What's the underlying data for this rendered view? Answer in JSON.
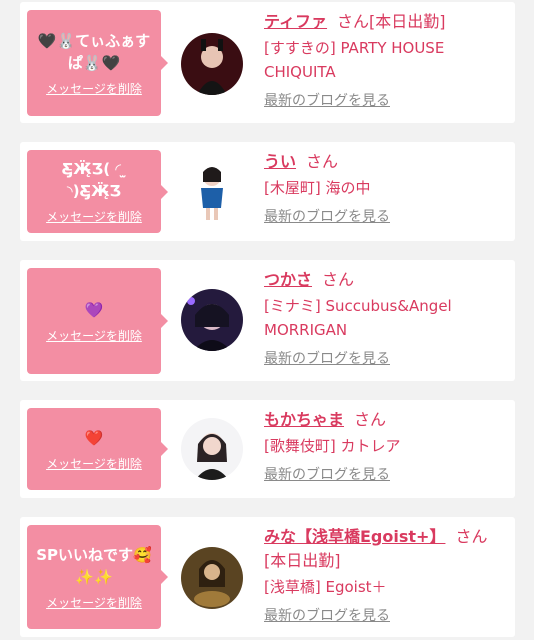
{
  "messages": [
    {
      "bubble_text": "🖤🐰てぃふぁすぱ🐰🖤",
      "delete_label": "メッセージを削除",
      "name": "ティファ",
      "san": "さん[本日出勤]",
      "shop": "[すすきの] PARTY HOUSE CHIQUITA",
      "blog_label": "最新のブログを見る"
    },
    {
      "bubble_text": "Ƹ̵̡Ӝ̵̨̄Ʒ( ◜ ̫ ◝)Ƹ̵̡Ӝ̵̨̄Ʒ",
      "delete_label": "メッセージを削除",
      "name": "うい",
      "san": "さん",
      "shop": "[木屋町] 海の中",
      "blog_label": "最新のブログを見る"
    },
    {
      "bubble_text": "💜",
      "delete_label": "メッセージを削除",
      "name": "つかさ",
      "san": "さん",
      "shop": "[ミナミ] Succubus&Angel MORRIGAN",
      "blog_label": "最新のブログを見る"
    },
    {
      "bubble_text": "❤️",
      "delete_label": "メッセージを削除",
      "name": "もかちゃま",
      "san": "さん",
      "shop": "[歌舞伎町] カトレア",
      "blog_label": "最新のブログを見る"
    },
    {
      "bubble_text": "SPいいねです🥰✨✨",
      "delete_label": "メッセージを削除",
      "name": "みな【浅草橋Egoist+】",
      "san": "さん[本日出勤]",
      "shop": "[浅草橋] Egoist＋",
      "blog_label": "最新のブログを見る"
    }
  ],
  "colors": {
    "bubble": "#f38ea3",
    "accent": "#d93a5f",
    "link_gray": "#8a8a8a",
    "background": "#f2f2f2"
  }
}
